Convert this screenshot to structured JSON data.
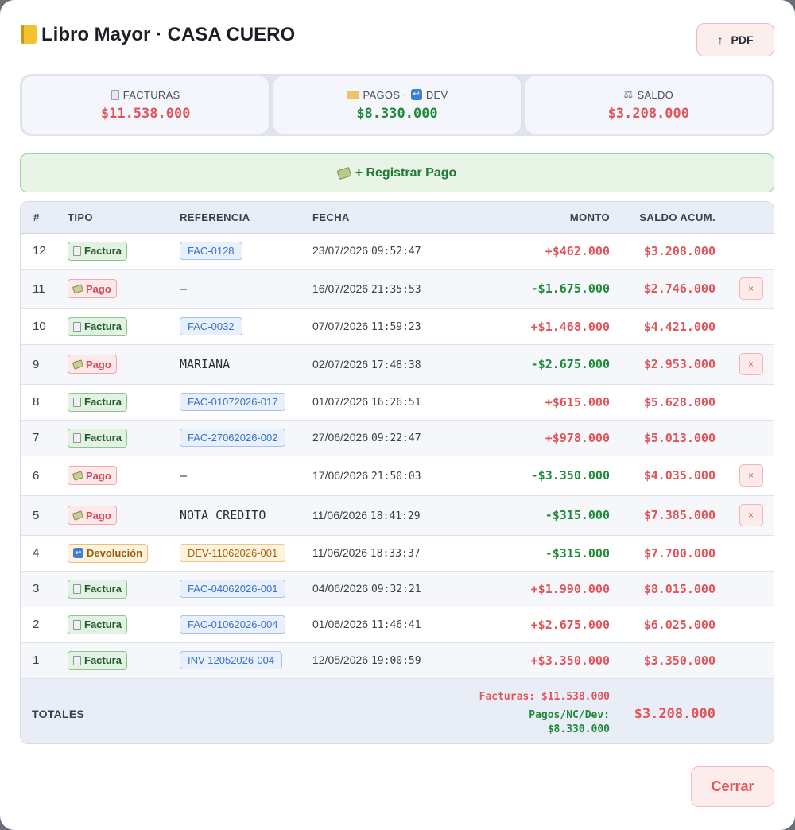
{
  "header": {
    "title": "Libro Mayor · CASA CUERO",
    "pdf_label": "PDF"
  },
  "summary": {
    "facturas_label": "FACTURAS",
    "facturas_value": "$11.538.000",
    "pagos_label": "PAGOS ·",
    "dev_label": "DEV",
    "pagos_value": "$8.330.000",
    "saldo_label": "SALDO",
    "saldo_value": "$3.208.000"
  },
  "actions": {
    "register_payment": "+ Registrar Pago",
    "close": "Cerrar"
  },
  "table": {
    "headers": {
      "num": "#",
      "tipo": "TIPO",
      "referencia": "REFERENCIA",
      "fecha": "FECHA",
      "monto": "MONTO",
      "saldo": "SALDO ACUM."
    },
    "rows": [
      {
        "num": "12",
        "tipo": "Factura",
        "kind": "factura",
        "ref": "FAC-0128",
        "ref_kind": "fac",
        "date": "23/07/2026",
        "time": "09:52:47",
        "monto": "+$462.000",
        "monto_sign": "pos",
        "saldo": "$3.208.000",
        "deletable": false
      },
      {
        "num": "11",
        "tipo": "Pago",
        "kind": "pago",
        "ref": "—",
        "ref_kind": "plain",
        "date": "16/07/2026",
        "time": "21:35:53",
        "monto": "-$1.675.000",
        "monto_sign": "neg",
        "saldo": "$2.746.000",
        "deletable": true
      },
      {
        "num": "10",
        "tipo": "Factura",
        "kind": "factura",
        "ref": "FAC-0032",
        "ref_kind": "fac",
        "date": "07/07/2026",
        "time": "11:59:23",
        "monto": "+$1.468.000",
        "monto_sign": "pos",
        "saldo": "$4.421.000",
        "deletable": false
      },
      {
        "num": "9",
        "tipo": "Pago",
        "kind": "pago",
        "ref": "MARIANA",
        "ref_kind": "plain",
        "date": "02/07/2026",
        "time": "17:48:38",
        "monto": "-$2.675.000",
        "monto_sign": "neg",
        "saldo": "$2.953.000",
        "deletable": true
      },
      {
        "num": "8",
        "tipo": "Factura",
        "kind": "factura",
        "ref": "FAC-01072026-017",
        "ref_kind": "fac",
        "date": "01/07/2026",
        "time": "16:26:51",
        "monto": "+$615.000",
        "monto_sign": "pos",
        "saldo": "$5.628.000",
        "deletable": false
      },
      {
        "num": "7",
        "tipo": "Factura",
        "kind": "factura",
        "ref": "FAC-27062026-002",
        "ref_kind": "fac",
        "date": "27/06/2026",
        "time": "09:22:47",
        "monto": "+$978.000",
        "monto_sign": "pos",
        "saldo": "$5.013.000",
        "deletable": false
      },
      {
        "num": "6",
        "tipo": "Pago",
        "kind": "pago",
        "ref": "—",
        "ref_kind": "plain",
        "date": "17/06/2026",
        "time": "21:50:03",
        "monto": "-$3.350.000",
        "monto_sign": "neg",
        "saldo": "$4.035.000",
        "deletable": true
      },
      {
        "num": "5",
        "tipo": "Pago",
        "kind": "pago",
        "ref": "NOTA CREDITO",
        "ref_kind": "plain",
        "date": "11/06/2026",
        "time": "18:41:29",
        "monto": "-$315.000",
        "monto_sign": "neg",
        "saldo": "$7.385.000",
        "deletable": true
      },
      {
        "num": "4",
        "tipo": "Devolución",
        "kind": "dev",
        "ref": "DEV-11062026-001",
        "ref_kind": "dev",
        "date": "11/06/2026",
        "time": "18:33:37",
        "monto": "-$315.000",
        "monto_sign": "neg",
        "saldo": "$7.700.000",
        "deletable": false
      },
      {
        "num": "3",
        "tipo": "Factura",
        "kind": "factura",
        "ref": "FAC-04062026-001",
        "ref_kind": "fac",
        "date": "04/06/2026",
        "time": "09:32:21",
        "monto": "+$1.990.000",
        "monto_sign": "pos",
        "saldo": "$8.015.000",
        "deletable": false
      },
      {
        "num": "2",
        "tipo": "Factura",
        "kind": "factura",
        "ref": "FAC-01062026-004",
        "ref_kind": "fac",
        "date": "01/06/2026",
        "time": "11:46:41",
        "monto": "+$2.675.000",
        "monto_sign": "pos",
        "saldo": "$6.025.000",
        "deletable": false
      },
      {
        "num": "1",
        "tipo": "Factura",
        "kind": "factura",
        "ref": "INV-12052026-004",
        "ref_kind": "fac",
        "date": "12/05/2026",
        "time": "19:00:59",
        "monto": "+$3.350.000",
        "monto_sign": "pos",
        "saldo": "$3.350.000",
        "deletable": false
      }
    ],
    "delete_glyph": "×",
    "totals": {
      "label": "TOTALES",
      "facturas_line": "Facturas: $11.538.000",
      "pagos_line_1": "Pagos/NC/Dev:",
      "pagos_line_2": "$8.330.000",
      "saldo": "$3.208.000"
    }
  },
  "icons": {
    "title": "ledger-icon",
    "pdf": "arrow-up-icon",
    "facturas": "document-icon",
    "pagos": "credit-card-icon",
    "dev": "return-icon",
    "saldo": "scale-icon",
    "register_payment": "money-icon"
  },
  "colors": {
    "positive_amount": "#e0555a",
    "negative_amount": "#1f8a3a",
    "saldo": "#e0555a",
    "factura_badge": "#e3f3e3",
    "pago_badge": "#fde8ea",
    "devolucion_badge": "#fff2dc"
  }
}
